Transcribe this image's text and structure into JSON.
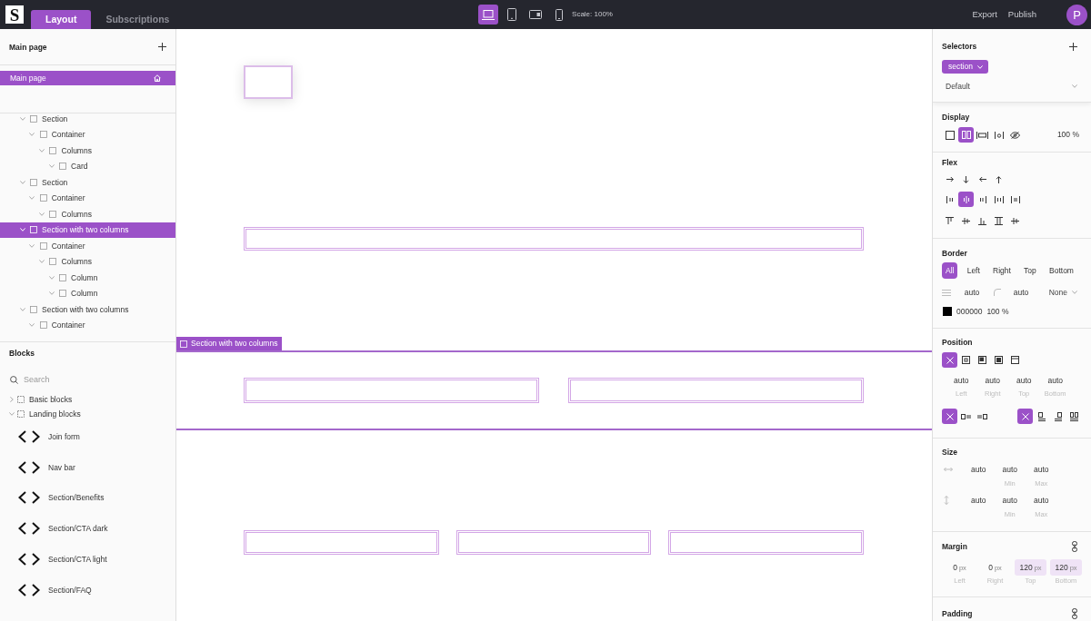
{
  "topbar": {
    "logo": "S",
    "tabs": [
      {
        "label": "Layout",
        "selected": true
      },
      {
        "label": "Subscriptions",
        "selected": false
      }
    ],
    "devices": [
      {
        "kind": "laptop",
        "selected": true
      },
      {
        "kind": "tablet",
        "selected": false
      },
      {
        "kind": "tablet-landscape",
        "selected": false
      },
      {
        "kind": "phone",
        "selected": false
      }
    ],
    "scale": "Scale: 100%",
    "actions": [
      "Export",
      "Publish"
    ],
    "avatar": "P"
  },
  "pages": {
    "title": "Main page",
    "items": [
      {
        "label": "Main page",
        "selected": true,
        "home": true
      }
    ]
  },
  "navigator": {
    "items": [
      {
        "label": "Section",
        "expanded": true,
        "selected": false,
        "children": [
          {
            "label": "Container",
            "expanded": true,
            "selected": false,
            "children": [
              {
                "label": "Columns",
                "expanded": true,
                "selected": false,
                "children": [
                  {
                    "label": "Card",
                    "expanded": true,
                    "selected": false
                  }
                ]
              }
            ]
          }
        ]
      },
      {
        "label": "Section",
        "expanded": true,
        "selected": false,
        "children": [
          {
            "label": "Container",
            "expanded": true,
            "selected": false,
            "children": [
              {
                "label": "Columns",
                "expanded": true,
                "selected": false
              }
            ]
          }
        ]
      },
      {
        "label": "Section with two columns",
        "expanded": true,
        "selected": true,
        "children": [
          {
            "label": "Container",
            "expanded": true,
            "selected": false,
            "children": [
              {
                "label": "Columns",
                "expanded": true,
                "selected": false,
                "children": [
                  {
                    "label": "Column",
                    "expanded": true,
                    "selected": false
                  },
                  {
                    "label": "Column",
                    "expanded": true,
                    "selected": false
                  }
                ]
              }
            ]
          }
        ]
      },
      {
        "label": "Section with two columns",
        "expanded": true,
        "selected": false,
        "children": [
          {
            "label": "Container",
            "expanded": true,
            "selected": false
          }
        ]
      }
    ]
  },
  "blocks": {
    "title": "Blocks",
    "search": {
      "placeholder": "Search"
    },
    "groups": [
      {
        "label": "Basic blocks",
        "expanded": false
      },
      {
        "label": "Landing blocks",
        "expanded": true,
        "items": [
          "Join form",
          "Nav bar",
          "Section/Benefits",
          "Section/CTA dark",
          "Section/CTA light",
          "Section/FAQ"
        ]
      }
    ]
  },
  "canvas": {
    "sections": [
      {
        "kind": "card",
        "selected": false
      },
      {
        "kind": "one-column",
        "selected": false
      },
      {
        "kind": "two-columns",
        "selected": true,
        "label": "Section with two columns"
      },
      {
        "kind": "three-columns",
        "selected": false
      }
    ]
  },
  "inspector": {
    "selectors": {
      "title": "Selectors",
      "chip": "section",
      "state": "Default"
    },
    "display": {
      "title": "Display",
      "options": [
        {
          "kind": "block",
          "selected": false
        },
        {
          "kind": "flex",
          "selected": true
        },
        {
          "kind": "inline-block",
          "selected": false
        },
        {
          "kind": "inline",
          "selected": false
        },
        {
          "kind": "hidden",
          "selected": false
        }
      ],
      "opacity": "100 %"
    },
    "flex": {
      "title": "Flex",
      "direction": [
        {
          "kind": "right",
          "selected": false
        },
        {
          "kind": "down",
          "selected": false
        },
        {
          "kind": "left",
          "selected": false
        },
        {
          "kind": "up",
          "selected": false
        }
      ],
      "justify": [
        {
          "kind": "start",
          "selected": false
        },
        {
          "kind": "center",
          "selected": true
        },
        {
          "kind": "end",
          "selected": false
        },
        {
          "kind": "between",
          "selected": false
        },
        {
          "kind": "around",
          "selected": false
        }
      ],
      "align": [
        {
          "kind": "start",
          "selected": false
        },
        {
          "kind": "center",
          "selected": false
        },
        {
          "kind": "end",
          "selected": false
        },
        {
          "kind": "stretch",
          "selected": false
        },
        {
          "kind": "baseline",
          "selected": false
        }
      ]
    },
    "border": {
      "title": "Border",
      "sides": [
        {
          "label": "All",
          "selected": true
        },
        {
          "label": "Left",
          "selected": false
        },
        {
          "label": "Right",
          "selected": false
        },
        {
          "label": "Top",
          "selected": false
        },
        {
          "label": "Bottom",
          "selected": false
        }
      ],
      "width": "auto",
      "radius": "auto",
      "style": "None",
      "color": "000000",
      "opacity": "100 %"
    },
    "position": {
      "title": "Position",
      "modes": [
        {
          "kind": "none",
          "selected": true
        },
        {
          "kind": "relative",
          "selected": false
        },
        {
          "kind": "absolute",
          "selected": false
        },
        {
          "kind": "fixed",
          "selected": false
        },
        {
          "kind": "sticky",
          "selected": false
        }
      ],
      "offsets": [
        {
          "value": "auto",
          "label": "Left"
        },
        {
          "value": "auto",
          "label": "Right"
        },
        {
          "value": "auto",
          "label": "Top"
        },
        {
          "value": "auto",
          "label": "Bottom"
        }
      ],
      "float": [
        {
          "kind": "none",
          "selected": true
        },
        {
          "kind": "left",
          "selected": false
        },
        {
          "kind": "right",
          "selected": false
        }
      ],
      "clear": [
        {
          "kind": "none",
          "selected": true
        },
        {
          "kind": "left",
          "selected": false
        },
        {
          "kind": "right",
          "selected": false
        },
        {
          "kind": "both",
          "selected": false
        }
      ]
    },
    "size": {
      "title": "Size",
      "rows": [
        {
          "kind": "width",
          "fields": [
            {
              "value": "auto"
            },
            {
              "value": "auto",
              "label": "Min"
            },
            {
              "value": "auto",
              "label": "Max"
            }
          ]
        },
        {
          "kind": "height",
          "fields": [
            {
              "value": "auto"
            },
            {
              "value": "auto",
              "label": "Min"
            },
            {
              "value": "auto",
              "label": "Max"
            }
          ]
        }
      ]
    },
    "margin": {
      "title": "Margin",
      "fields": [
        {
          "value": "0",
          "unit": "px",
          "label": "Left",
          "modified": false
        },
        {
          "value": "0",
          "unit": "px",
          "label": "Right",
          "modified": false
        },
        {
          "value": "120",
          "unit": "px",
          "label": "Top",
          "modified": true
        },
        {
          "value": "120",
          "unit": "px",
          "label": "Bottom",
          "modified": true
        }
      ]
    },
    "padding": {
      "title": "Padding"
    }
  }
}
